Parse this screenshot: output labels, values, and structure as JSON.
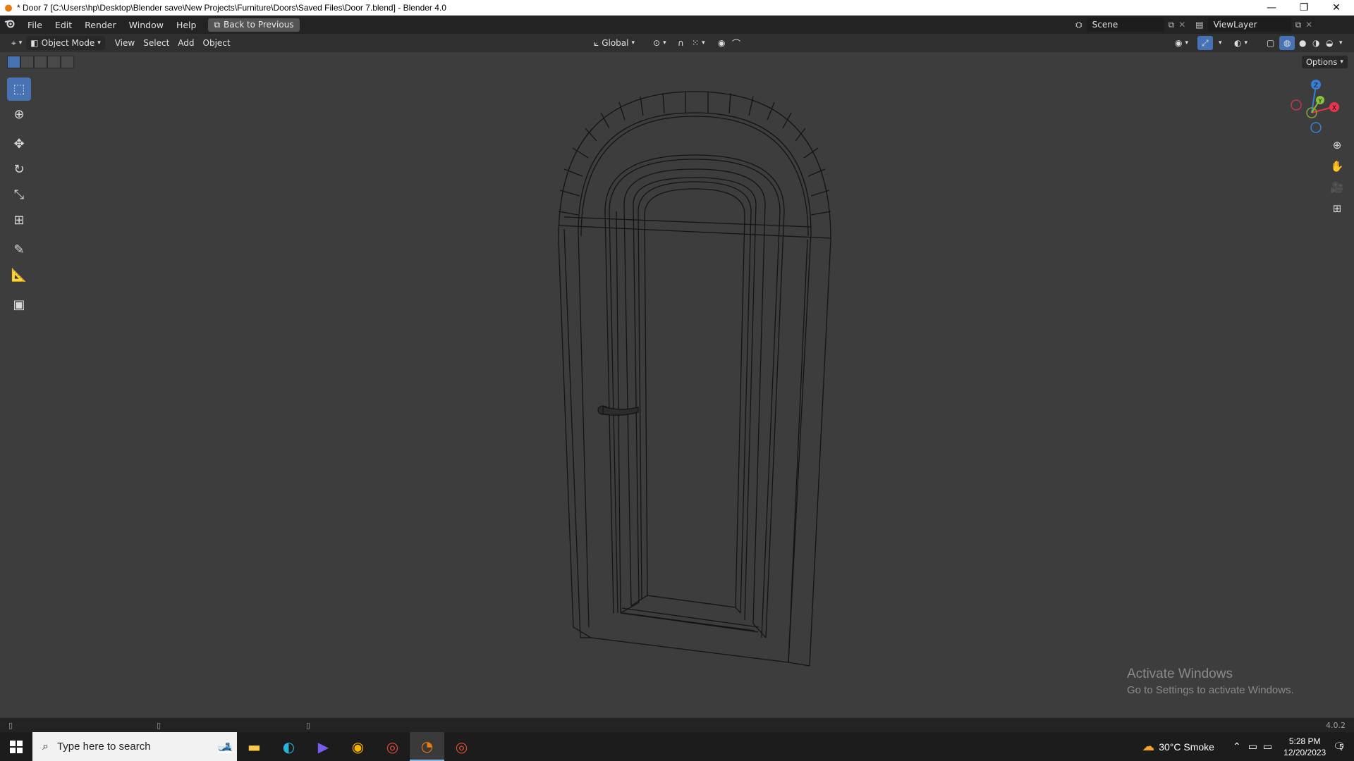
{
  "window": {
    "title": "* Door 7 [C:\\Users\\hp\\Desktop\\Blender save\\New Projects\\Furniture\\Doors\\Saved Files\\Door 7.blend] - Blender 4.0",
    "min_glyph": "—",
    "restore_glyph": "❐",
    "close_glyph": "✕"
  },
  "menubar": {
    "items": [
      "File",
      "Edit",
      "Render",
      "Window",
      "Help"
    ],
    "back_button": "Back to Previous",
    "scene": "Scene",
    "view_layer": "ViewLayer"
  },
  "viewport_header": {
    "mode": "Object Mode",
    "menus": [
      "View",
      "Select",
      "Add",
      "Object"
    ],
    "orientation": "Global",
    "options": "Options"
  },
  "gizmo": {
    "z": "Z",
    "y": "Y",
    "x": "X",
    "colors": {
      "x": "#e8344c",
      "y": "#8bc33a",
      "z": "#3a7fd6"
    }
  },
  "activate_windows": {
    "line1": "Activate Windows",
    "line2": "Go to Settings to activate Windows."
  },
  "statusbar": {
    "version": "4.0.2"
  },
  "taskbar": {
    "search_placeholder": "Type here to search",
    "weather": "30°C  Smoke",
    "time": "5:28 PM",
    "date": "12/20/2023",
    "notification_count": "5"
  }
}
